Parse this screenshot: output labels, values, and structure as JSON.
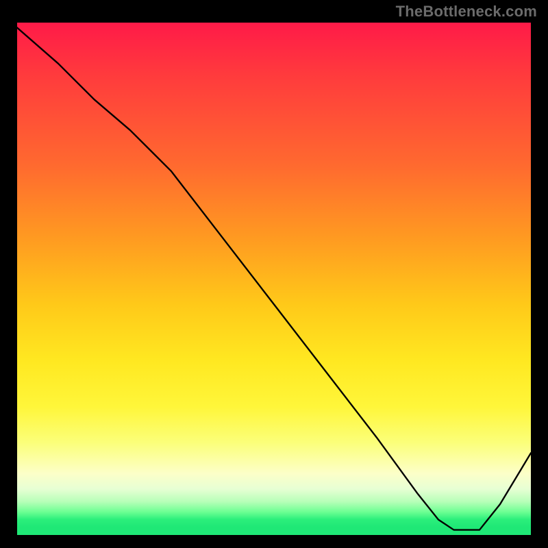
{
  "watermark": "TheBottleneck.com",
  "bottom_label": "",
  "colors": {
    "page_bg": "#000000",
    "curve": "#000000",
    "watermark": "#6b6b6b",
    "bottom_label": "#b33b2c",
    "gradient_top": "#ff1a48",
    "gradient_bottom": "#1fe876"
  },
  "chart_data": {
    "type": "line",
    "title": "",
    "xlabel": "",
    "ylabel": "",
    "xlim": [
      0,
      100
    ],
    "ylim": [
      0,
      100
    ],
    "grid": false,
    "legend": false,
    "series": [
      {
        "name": "curve",
        "x": [
          0,
          8,
          15,
          22,
          26,
          30,
          40,
          50,
          60,
          70,
          78,
          82,
          85,
          88,
          90,
          94,
          100
        ],
        "values": [
          99,
          92,
          85,
          79,
          75,
          71,
          58,
          45,
          32,
          19,
          8,
          3,
          1,
          1,
          1,
          6,
          16
        ],
        "note": "y is relative height in percent of plot area (visual estimate); minimum plateau around x≈85–88"
      }
    ]
  }
}
